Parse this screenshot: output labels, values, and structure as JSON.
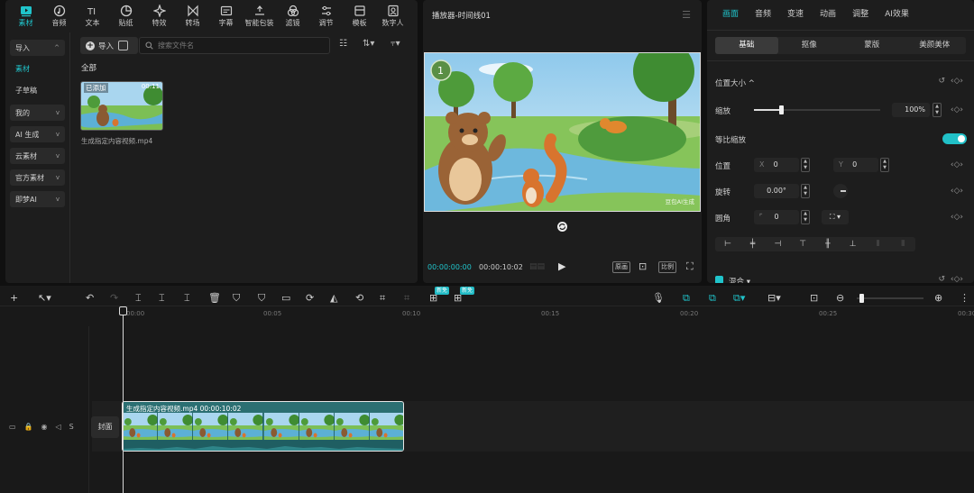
{
  "media_panel": {
    "top_tabs": [
      {
        "label": "素材",
        "icon": "media-icon",
        "active": true
      },
      {
        "label": "音频",
        "icon": "audio-icon"
      },
      {
        "label": "文本",
        "icon": "text-icon"
      },
      {
        "label": "贴纸",
        "icon": "sticker-icon"
      },
      {
        "label": "特效",
        "icon": "effects-icon"
      },
      {
        "label": "转场",
        "icon": "transition-icon"
      },
      {
        "label": "字幕",
        "icon": "subtitle-icon"
      },
      {
        "label": "智能包装",
        "icon": "smart-pack-icon"
      },
      {
        "label": "滤镜",
        "icon": "filter-icon"
      },
      {
        "label": "调节",
        "icon": "adjust-icon"
      },
      {
        "label": "模板",
        "icon": "template-icon"
      },
      {
        "label": "数字人",
        "icon": "digital-human-icon"
      }
    ],
    "sidebar": {
      "items": [
        {
          "label": "导入",
          "chevron": "^"
        },
        {
          "label": "素材"
        },
        {
          "label": "子草稿"
        },
        {
          "label": "我的",
          "chevron": "v"
        },
        {
          "label": "AI 生成",
          "chevron": "v"
        },
        {
          "label": "云素材",
          "chevron": "v"
        },
        {
          "label": "官方素材",
          "chevron": "v"
        },
        {
          "label": "即梦AI",
          "chevron": "v"
        }
      ]
    },
    "import_button": "导入",
    "search_placeholder": "搜索文件名",
    "section_title": "全部",
    "asset": {
      "added_tag": "已添加",
      "duration": "00:11",
      "filename": "生成指定内容视频.mp4"
    }
  },
  "player": {
    "title": "播放器-时间线01",
    "watermark": "豆包AI生成",
    "current_time": "00:00:00:00",
    "total_time": "00:00:10:02",
    "original_button": "原画",
    "ratio_button": "比例"
  },
  "properties": {
    "tabs": [
      "画面",
      "音频",
      "变速",
      "动画",
      "调整",
      "AI效果"
    ],
    "subtabs": [
      "基础",
      "抠像",
      "蒙版",
      "美颜美体"
    ],
    "position_size_label": "位置大小",
    "scale_label": "缩放",
    "scale_value": "100%",
    "scale_fraction": 1.0,
    "uniform_scale_label": "等比缩放",
    "uniform_scale_on": true,
    "position_label": "位置",
    "x_label": "X",
    "x_value": "0",
    "y_label": "Y",
    "y_value": "0",
    "rotation_label": "旋转",
    "rotation_value": "0.00°",
    "corner_label": "圆角",
    "corner_value": "0",
    "blend_label": "混合"
  },
  "timeline": {
    "ruler": [
      "00:00",
      "00:05",
      "00:10",
      "00:15",
      "00:20",
      "00:25",
      "00:30"
    ],
    "badges": [
      "新免",
      "新免"
    ],
    "cover_label": "封面",
    "clip_label": "生成指定内容视频.mp4   00:00:10:02"
  },
  "colors": {
    "accent": "#20c4cb",
    "panel": "#1d1d1d",
    "background": "#101010"
  }
}
